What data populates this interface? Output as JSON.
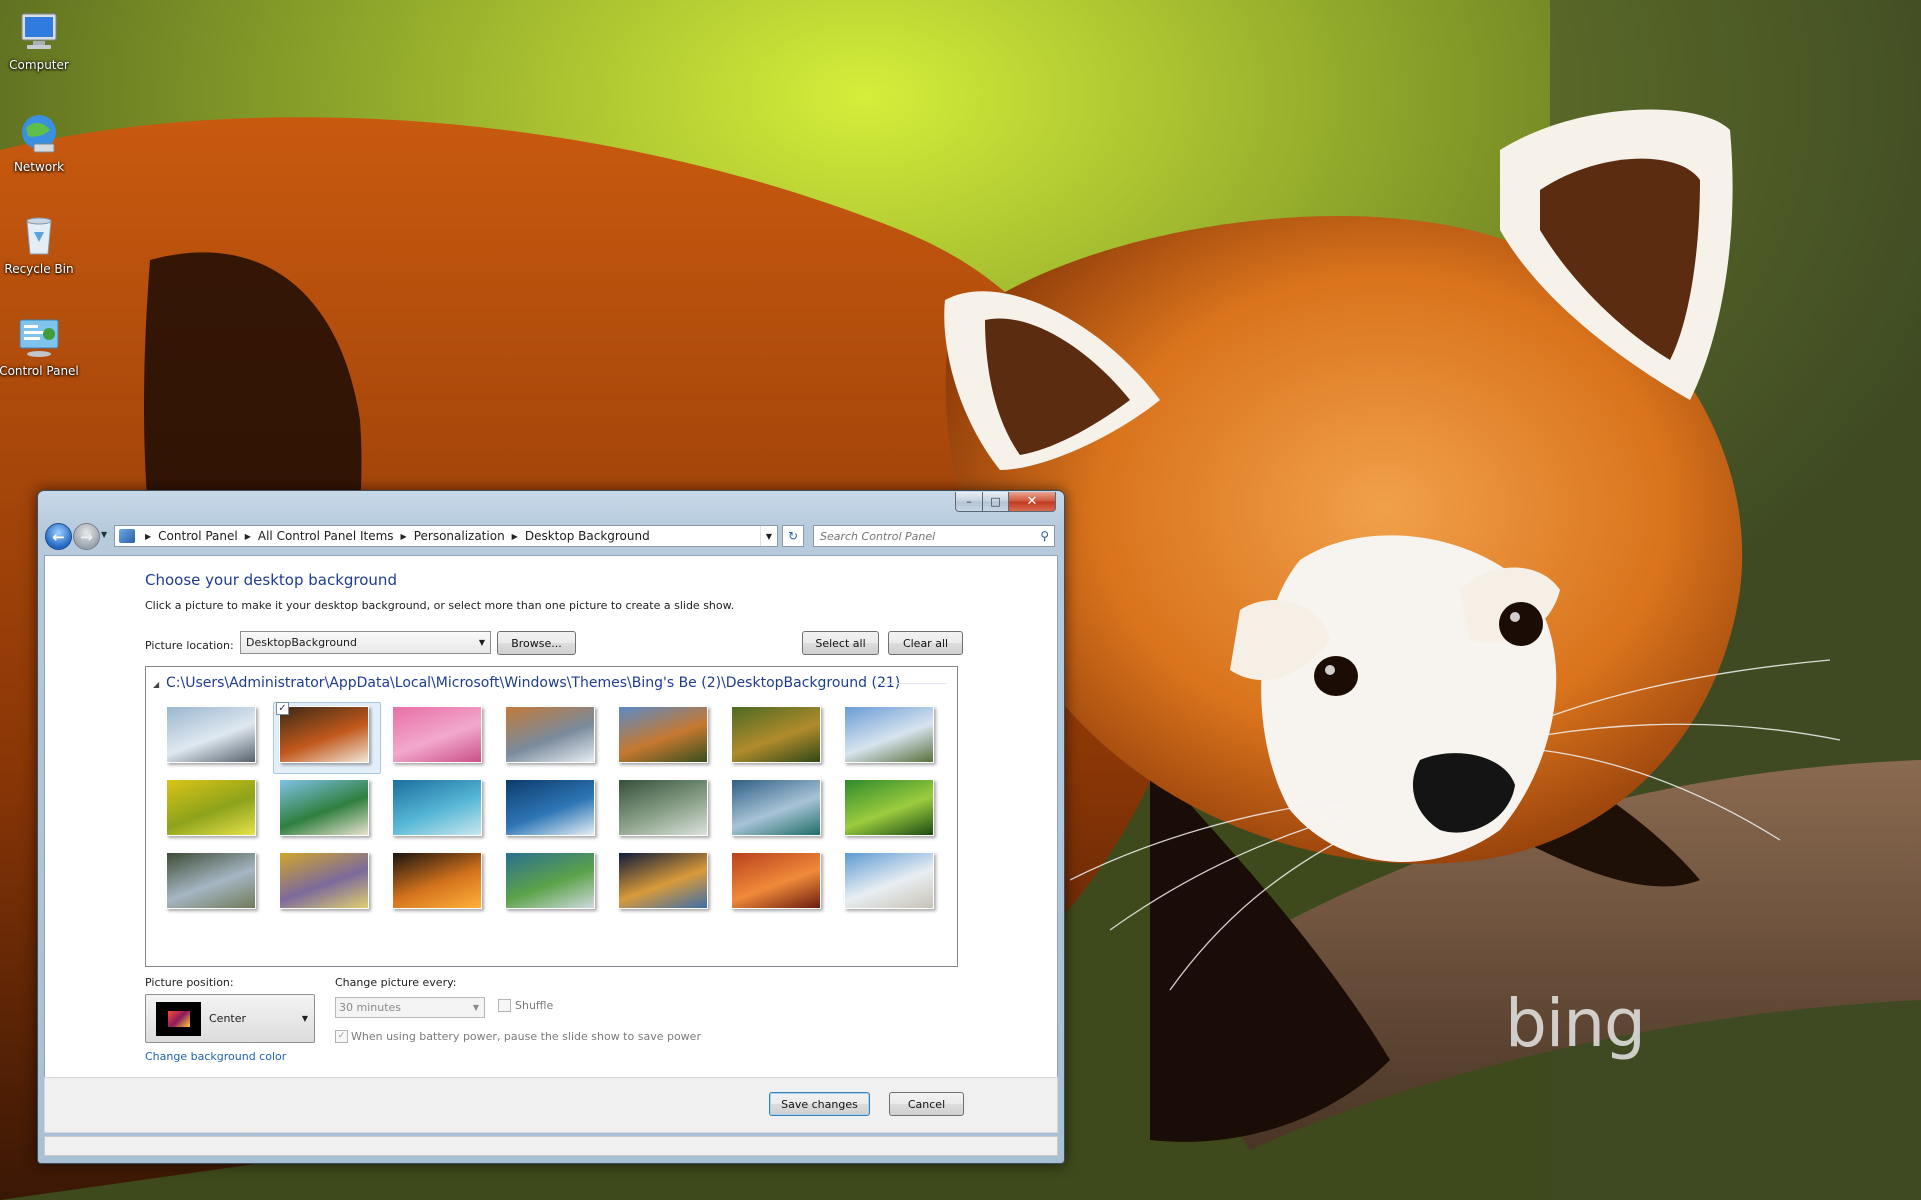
{
  "desktop": {
    "icons": [
      {
        "label": "Computer"
      },
      {
        "label": "Network"
      },
      {
        "label": "Recycle Bin"
      },
      {
        "label": "Control Panel"
      }
    ],
    "wallpaper_logo": "bing"
  },
  "window": {
    "caption": {
      "minimize": "–",
      "maximize": "□",
      "close": "✕"
    },
    "address": {
      "crumbs": [
        "Control Panel",
        "All Control Panel Items",
        "Personalization",
        "Desktop Background"
      ]
    },
    "search": {
      "placeholder": "Search Control Panel"
    },
    "heading": "Choose your desktop background",
    "subtext": "Click a picture to make it your desktop background, or select more than one picture to create a slide show.",
    "picture_location": {
      "label": "Picture location:",
      "value": "DesktopBackground",
      "browse": "Browse...",
      "select_all": "Select all",
      "clear_all": "Clear all"
    },
    "gallery": {
      "path": "C:\\Users\\Administrator\\AppData\\Local\\Microsoft\\Windows\\Themes\\Bing's Be (2)\\DesktopBackground (21)",
      "selected_index": 1,
      "thumbnails": [
        {
          "colors": [
            "#9bb6cf",
            "#dfe8f0",
            "#55606b"
          ]
        },
        {
          "colors": [
            "#3b2a16",
            "#c2581c",
            "#f0e6d6"
          ]
        },
        {
          "colors": [
            "#e86fa6",
            "#f2a8cc",
            "#c94f88"
          ]
        },
        {
          "colors": [
            "#c27a3a",
            "#7a8a9c",
            "#e7eef3"
          ]
        },
        {
          "colors": [
            "#5b8ac8",
            "#c6782f",
            "#384f1f"
          ]
        },
        {
          "colors": [
            "#4d6a23",
            "#b18b2c",
            "#2f4717"
          ]
        },
        {
          "colors": [
            "#6a9bd6",
            "#d7e4ef",
            "#596f3a"
          ]
        },
        {
          "colors": [
            "#d9c417",
            "#8da21b",
            "#e7e24a"
          ]
        },
        {
          "colors": [
            "#7fc2e8",
            "#2f7f3f",
            "#e9e2cf"
          ]
        },
        {
          "colors": [
            "#1a6f9e",
            "#57b7d6",
            "#c9e7ee"
          ]
        },
        {
          "colors": [
            "#0d3b6b",
            "#2d76b6",
            "#e7eff6"
          ]
        },
        {
          "colors": [
            "#34503a",
            "#8aa088",
            "#dbe2dc"
          ]
        },
        {
          "colors": [
            "#2f5f86",
            "#a8c3d6",
            "#1f6d68"
          ]
        },
        {
          "colors": [
            "#2f8a2d",
            "#9ccc3e",
            "#1b4a14"
          ]
        },
        {
          "colors": [
            "#3d4d36",
            "#a6b6c4",
            "#6f7a58"
          ]
        },
        {
          "colors": [
            "#d1a52b",
            "#7c6a9d",
            "#e0cf6f"
          ]
        },
        {
          "colors": [
            "#1b1410",
            "#d4731d",
            "#ffb13b"
          ]
        },
        {
          "colors": [
            "#2b6f8e",
            "#5ca34a",
            "#cfd9de"
          ]
        },
        {
          "colors": [
            "#0e1a3a",
            "#d99a3a",
            "#3d6ea8"
          ]
        },
        {
          "colors": [
            "#b8421c",
            "#f08a3a",
            "#6b1c0f"
          ]
        },
        {
          "colors": [
            "#5d9ad3",
            "#e8eef2",
            "#c8c2b6"
          ]
        }
      ]
    },
    "picture_position": {
      "label": "Picture position:",
      "value": "Center"
    },
    "change_picture": {
      "label": "Change picture every:",
      "value": "30 minutes",
      "shuffle": "Shuffle",
      "battery": "When using battery power, pause the slide show to save power"
    },
    "link": "Change background color",
    "buttons": {
      "save": "Save changes",
      "cancel": "Cancel"
    }
  }
}
